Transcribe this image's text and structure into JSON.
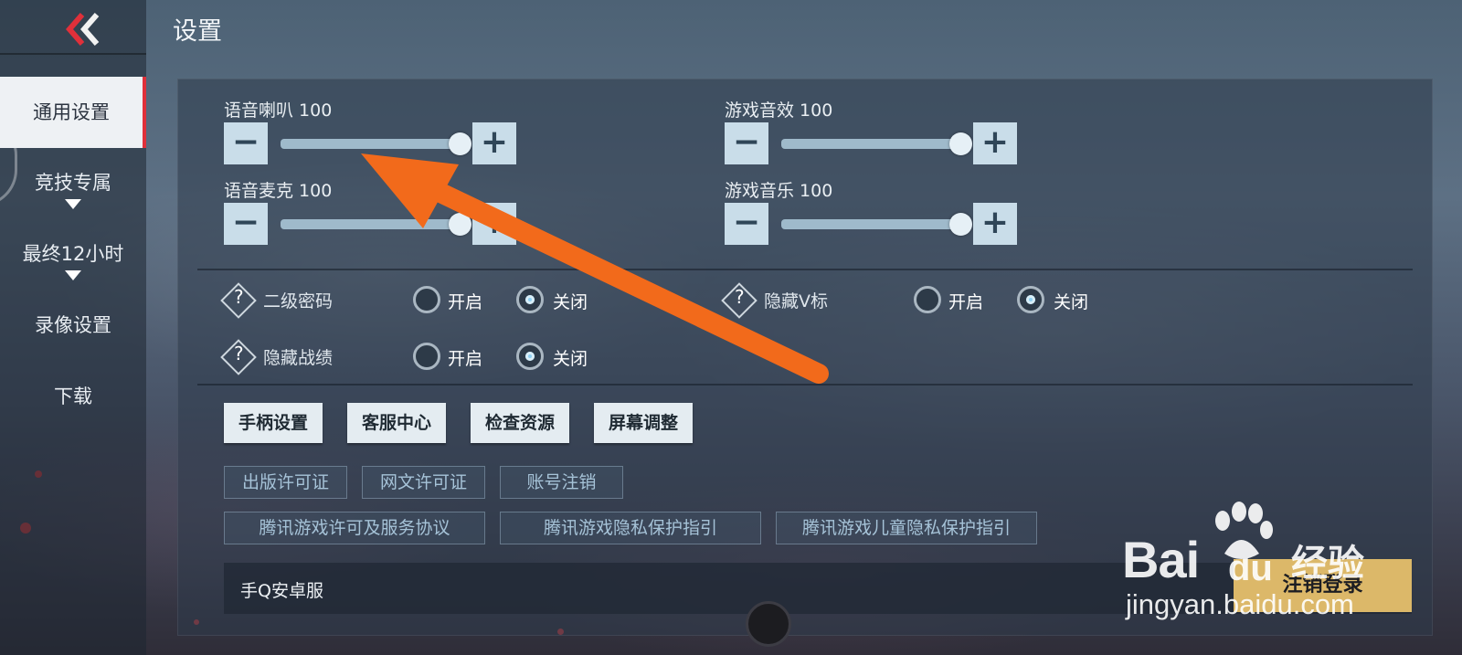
{
  "page_title": "设置",
  "sidebar": {
    "items": [
      {
        "label": "通用设置",
        "active": true
      },
      {
        "label": "竞技专属",
        "dropdown": true
      },
      {
        "label": "最终12小时",
        "dropdown": true
      },
      {
        "label": "录像设置"
      },
      {
        "label": "下载"
      }
    ]
  },
  "sliders": [
    {
      "label": "语音喇叭 100",
      "value": 100
    },
    {
      "label": "游戏音效 100",
      "value": 100
    },
    {
      "label": "语音麦克 100",
      "value": 100
    },
    {
      "label": "游戏音乐 100",
      "value": 100
    }
  ],
  "options": [
    {
      "label": "二级密码",
      "on_label": "开启",
      "off_label": "关闭",
      "selected": "off"
    },
    {
      "label": "隐藏V标",
      "on_label": "开启",
      "off_label": "关闭",
      "selected": "off"
    },
    {
      "label": "隐藏战绩",
      "on_label": "开启",
      "off_label": "关闭",
      "selected": "off"
    }
  ],
  "action_buttons": [
    "手柄设置",
    "客服中心",
    "检查资源",
    "屏幕调整"
  ],
  "links_row1": [
    "出版许可证",
    "网文许可证",
    "账号注销"
  ],
  "links_row2": [
    "腾讯游戏许可及服务协议",
    "腾讯游戏隐私保护指引",
    "腾讯游戏儿童隐私保护指引"
  ],
  "footer": {
    "account_type": "手Q安卓服",
    "logout_label": "注销登录"
  },
  "watermark": {
    "brand": "Bai",
    "brand_du": "du",
    "suffix": "经验",
    "url": "jingyan.baidu.com"
  },
  "colors": {
    "annotation_arrow": "#f26a1b",
    "active_tab_accent": "#e0303a",
    "logout_button": "#dcb869"
  }
}
